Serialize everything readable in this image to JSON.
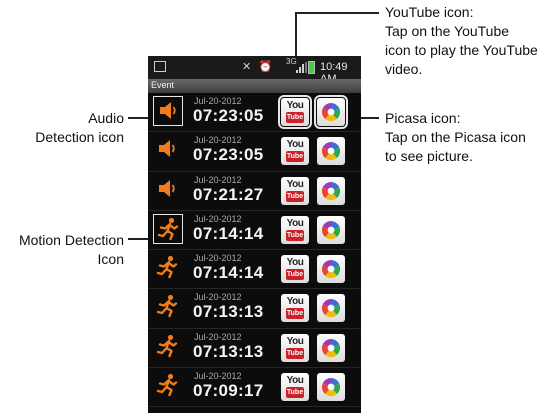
{
  "callouts": {
    "youtube": [
      "YouTube icon:",
      "Tap on the YouTube",
      "icon to play the YouTube",
      "video."
    ],
    "picasa": [
      "Picasa icon:",
      "Tap on the Picasa icon",
      "to see picture."
    ],
    "audio": [
      "Audio",
      "Detection icon"
    ],
    "motion": [
      "Motion Detection",
      "Icon"
    ]
  },
  "status_bar": {
    "time": "10:49 AM",
    "network": "3G"
  },
  "screen_title": "Event",
  "events": [
    {
      "type": "audio",
      "date": "Jul-20-2012",
      "time": "07:23:05"
    },
    {
      "type": "audio",
      "date": "Jul-20-2012",
      "time": "07:23:05"
    },
    {
      "type": "audio",
      "date": "Jul-20-2012",
      "time": "07:21:27"
    },
    {
      "type": "motion",
      "date": "Jul-20-2012",
      "time": "07:14:14"
    },
    {
      "type": "motion",
      "date": "Jul-20-2012",
      "time": "07:14:14"
    },
    {
      "type": "motion",
      "date": "Jul-20-2012",
      "time": "07:13:13"
    },
    {
      "type": "motion",
      "date": "Jul-20-2012",
      "time": "07:13:13"
    },
    {
      "type": "motion",
      "date": "Jul-20-2012",
      "time": "07:09:17"
    }
  ],
  "youtube_icon": {
    "top": "You",
    "bottom": "Tube"
  },
  "colors": {
    "accent_orange": "#f07d1a",
    "youtube_red": "#c8222a",
    "battery_green": "#3bd23b"
  }
}
